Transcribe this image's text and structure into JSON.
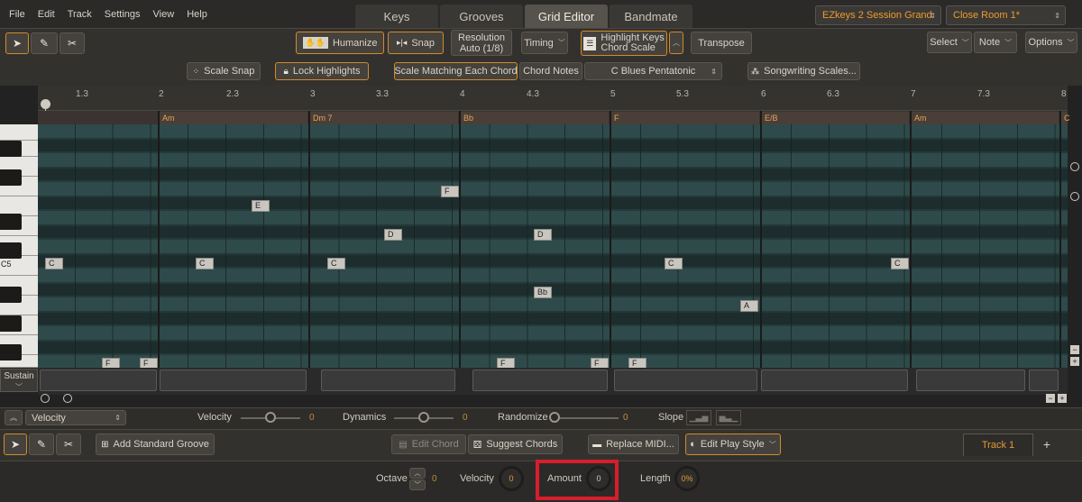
{
  "menu": [
    "File",
    "Edit",
    "Track",
    "Settings",
    "View",
    "Help"
  ],
  "tabs": [
    "Keys",
    "Grooves",
    "Grid Editor",
    "Bandmate"
  ],
  "active_tab": "Grid Editor",
  "instrument": "EZkeys 2 Session Grand",
  "room": "Close Room 1*",
  "toolbar": {
    "humanize": "Humanize",
    "snap": "Snap",
    "resolution_label": "Resolution",
    "resolution_value": "Auto (1/8)",
    "timing": "Timing",
    "highlight_keys": "Highlight Keys",
    "highlight_sub": "Chord Scale",
    "transpose": "Transpose",
    "select": "Select",
    "note": "Note",
    "options": "Options"
  },
  "scalebar": {
    "scale_snap": "Scale Snap",
    "lock_highlights": "Lock Highlights",
    "scale_matching": "Scale Matching Each Chord",
    "chord_notes": "Chord Notes",
    "scale_name": "C Blues Pentatonic",
    "songwriting": "Songwriting Scales..."
  },
  "ruler": [
    "1.3",
    "2",
    "2.3",
    "3",
    "3.3",
    "4",
    "4.3",
    "5",
    "5.3",
    "6",
    "6.3",
    "7",
    "7.3",
    "8"
  ],
  "chords": [
    "Am",
    "Dm 7",
    "Bb",
    "F",
    "E/B",
    "Am",
    "C"
  ],
  "notes": [
    "C",
    "E",
    "C",
    "C",
    "F",
    "D",
    "D",
    "Bb",
    "C",
    "A",
    "C",
    "F",
    "F",
    "F",
    "F",
    "F"
  ],
  "keys_label": "C5",
  "sustain_label": "Sustain",
  "params": {
    "lane_select": "Velocity",
    "velocity_label": "Velocity",
    "velocity_value": "0",
    "dynamics_label": "Dynamics",
    "dynamics_value": "0",
    "randomize_label": "Randomize",
    "randomize_value": "0",
    "slope_label": "Slope"
  },
  "bottom_toolbar": {
    "add_groove": "Add Standard Groove",
    "edit_chord": "Edit Chord",
    "suggest_chords": "Suggest Chords",
    "replace_midi": "Replace MIDI...",
    "edit_play_style": "Edit Play Style",
    "track": "Track 1",
    "add": "+"
  },
  "footer": {
    "octave_label": "Octave",
    "octave_value": "0",
    "velocity_label": "Velocity",
    "velocity_value": "0",
    "amount_label": "Amount",
    "amount_value": "0",
    "length_label": "Length",
    "length_value": "0%"
  },
  "colors": {
    "accent": "#e49a35",
    "grid_light": "#2f4a4a",
    "grid_dark": "#253a3a",
    "highlight_box": "#d81e2a"
  }
}
